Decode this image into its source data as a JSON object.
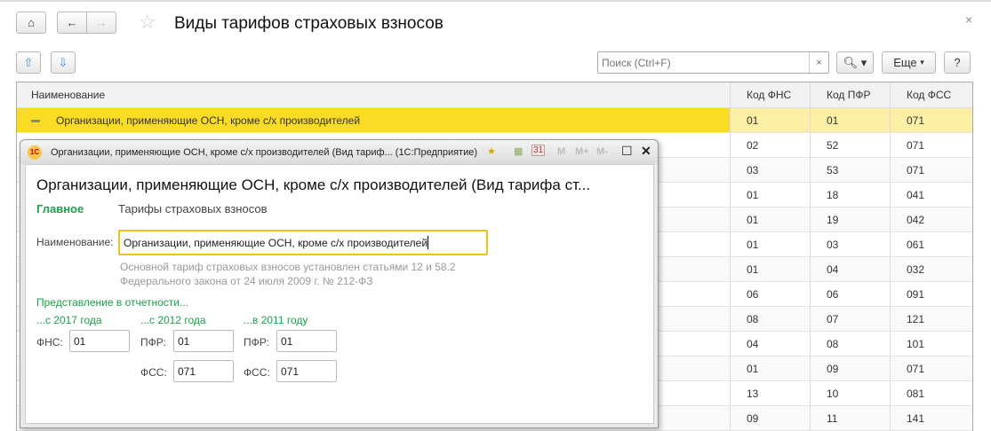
{
  "window": {
    "title": "Виды тарифов страховых взносов",
    "close": "×"
  },
  "toolbar": {
    "search_placeholder": "Поиск (Ctrl+F)",
    "search_clear": "×",
    "more_label": "Еще",
    "help_label": "?"
  },
  "table": {
    "headers": [
      "Наименование",
      "Код ФНС",
      "Код ПФР",
      "Код ФСС"
    ],
    "rows": [
      {
        "name": "Организации, применяющие ОСН, кроме с/х производителей",
        "fns": "01",
        "pfr": "01",
        "fss": "071"
      },
      {
        "name": "",
        "fns": "02",
        "pfr": "52",
        "fss": "071"
      },
      {
        "name": "",
        "fns": "03",
        "pfr": "53",
        "fss": "071"
      },
      {
        "name": "",
        "fns": "01",
        "pfr": "18",
        "fss": "041"
      },
      {
        "name": "",
        "fns": "01",
        "pfr": "19",
        "fss": "042"
      },
      {
        "name": "",
        "fns": "01",
        "pfr": "03",
        "fss": "061"
      },
      {
        "name": "",
        "fns": "01",
        "pfr": "04",
        "fss": "032"
      },
      {
        "name": "",
        "fns": "06",
        "pfr": "06",
        "fss": "091"
      },
      {
        "name": "",
        "fns": "08",
        "pfr": "07",
        "fss": "121"
      },
      {
        "name": "",
        "fns": "04",
        "pfr": "08",
        "fss": "101"
      },
      {
        "name": "",
        "fns": "01",
        "pfr": "09",
        "fss": "071"
      },
      {
        "name": "",
        "fns": "13",
        "pfr": "10",
        "fss": "081"
      },
      {
        "name": "",
        "fns": "09",
        "pfr": "11",
        "fss": "141"
      }
    ]
  },
  "modal": {
    "window_title": "Организации, применяющие ОСН, кроме с/х производителей (Вид тариф...  (1С:Предприятие)",
    "toolbar": {
      "m": "M",
      "mplus": "M+",
      "mminus": "M-",
      "calendar": "31"
    },
    "heading": "Организации, применяющие ОСН, кроме с/х производителей (Вид тарифа ст...",
    "tabs": [
      "Главное",
      "Тарифы страховых взносов"
    ],
    "name_label": "Наименование:",
    "name_value": "Организации, применяющие ОСН, кроме с/х производителей",
    "note": "Основной тариф страховых взносов установлен статьями 12 и 58.2 Федерального закона от 24 июля 2009 г. № 212-ФЗ",
    "reporting_label": "Представление в отчетности...",
    "groups": [
      {
        "title": "...с 2017 года",
        "fields": [
          {
            "label": "ФНС:",
            "value": "01"
          }
        ]
      },
      {
        "title": "...с 2012 года",
        "fields": [
          {
            "label": "ПФР:",
            "value": "01"
          },
          {
            "label": "ФСС:",
            "value": "071"
          }
        ]
      },
      {
        "title": "...в 2011 году",
        "fields": [
          {
            "label": "ПФР:",
            "value": "01"
          },
          {
            "label": "ФСС:",
            "value": "071"
          }
        ]
      }
    ]
  }
}
